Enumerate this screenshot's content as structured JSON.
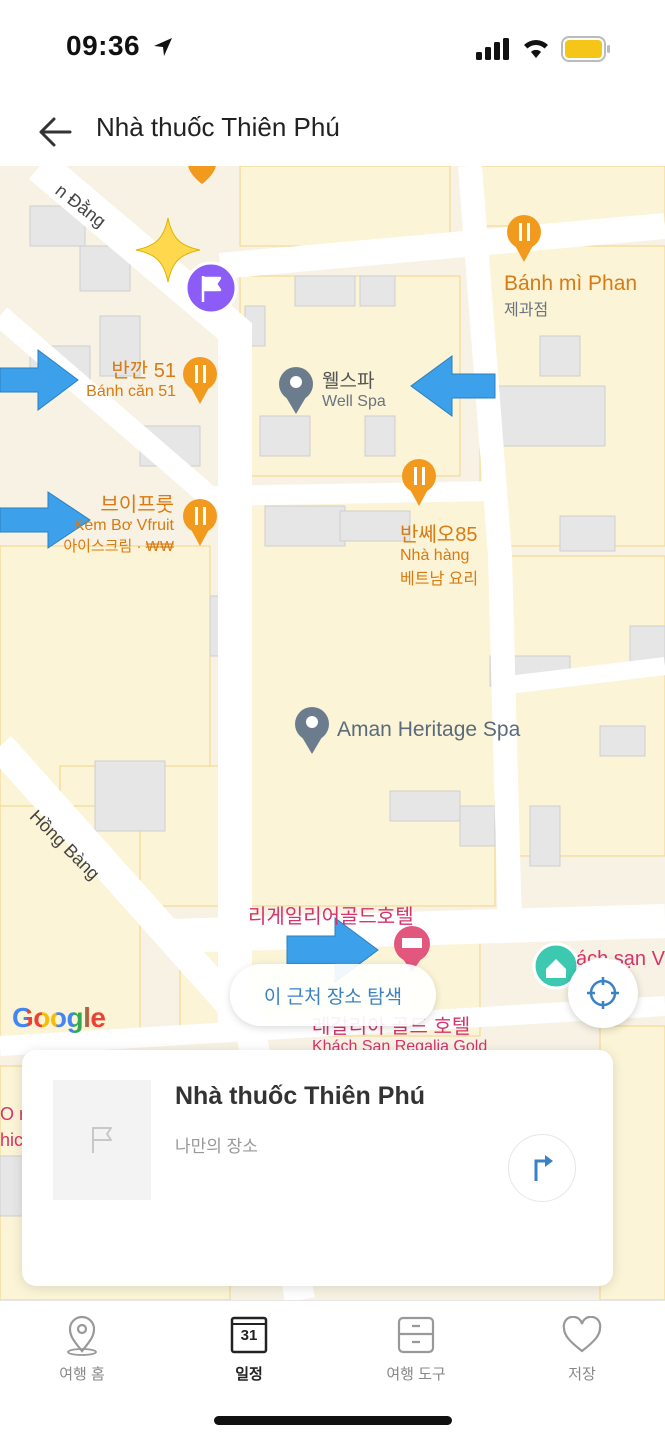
{
  "status_bar": {
    "time": "09:36"
  },
  "header": {
    "title": "Nhà thuốc Thiên Phú"
  },
  "map": {
    "roads": {
      "road_top": "n Đằng",
      "road_hong_bang": "Hồng Bàng"
    },
    "places": {
      "banh_mi_phan": {
        "name": "Bánh mì Phan",
        "sub": "제과점"
      },
      "well_spa": {
        "name": "웰스파",
        "sub": "Well Spa"
      },
      "banh_can_51": {
        "name": "반깐 51",
        "sub": "Bánh căn 51"
      },
      "vfruit": {
        "name": "브이프룻",
        "sub": "Kem Bơ Vfruit",
        "sub2": "아이스크림 · ₩₩"
      },
      "banh_xeo_85": {
        "name": "반쎄오85",
        "sub": "Nhà hàng",
        "sub2": "베트남 요리"
      },
      "aman": {
        "name": "Aman Heritage Spa"
      },
      "regalia": {
        "name": "리게일리어골드호텔",
        "sub": "레갈리아 골드 호텔",
        "sub2": "Khách Sạn Regalia Gold"
      },
      "partial_right": {
        "name": "ách sạn V"
      },
      "partial_left_1": {
        "name": "O n"
      },
      "partial_left_2": {
        "name": "hic"
      }
    },
    "search_area_label": "이 근처 장소 탐색",
    "google_logo": "Google"
  },
  "place_card": {
    "name": "Nhà thuốc Thiên Phú",
    "subtitle": "나만의 장소"
  },
  "tabbar": {
    "tabs": [
      {
        "label": "여행 홈",
        "icon": "location-pin-icon",
        "active": false
      },
      {
        "label": "일정",
        "icon": "calendar-icon",
        "active": true,
        "calendar_day": "31"
      },
      {
        "label": "여행 도구",
        "icon": "toolbox-icon",
        "active": false
      },
      {
        "label": "저장",
        "icon": "heart-icon",
        "active": false
      }
    ]
  },
  "colors": {
    "accent_blue": "#3b82c4",
    "poi_orange": "#f29a1d",
    "hotel_pink": "#e2577e",
    "flag_purple": "#8b5cf6",
    "arrow_blue": "#3da0ea"
  }
}
